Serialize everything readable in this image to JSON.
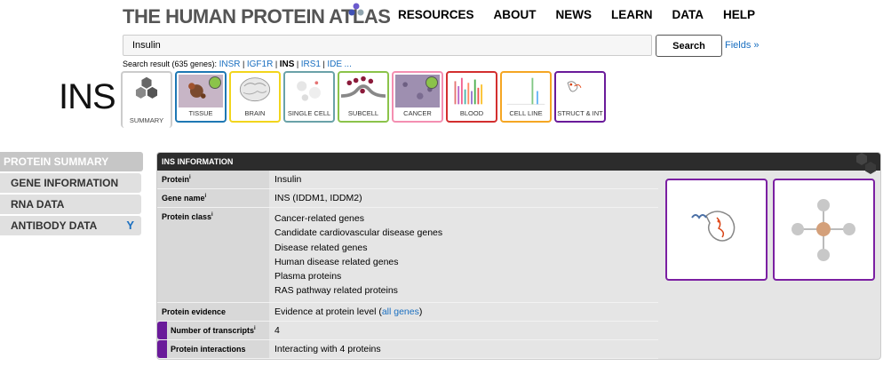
{
  "header": {
    "logo_text": "THE HUMAN PROTEIN ATLAS",
    "nav": [
      "RESOURCES",
      "ABOUT",
      "NEWS",
      "LEARN",
      "DATA",
      "HELP"
    ]
  },
  "search": {
    "value": "Insulin",
    "button_label": "Search",
    "fields_link": "Fields »",
    "result_prefix": "Search result (635 genes):",
    "results": [
      "INSR",
      "IGF1R",
      "INS",
      "IRS1",
      "IDE",
      "..."
    ],
    "result_sep": "|"
  },
  "gene": {
    "symbol": "INS"
  },
  "tabs": [
    {
      "label": "SUMMARY",
      "color": "#cccccc"
    },
    {
      "label": "TISSUE",
      "color": "#1e78b4"
    },
    {
      "label": "BRAIN",
      "color": "#f2d51c"
    },
    {
      "label": "SINGLE CELL",
      "color": "#6aa2a8"
    },
    {
      "label": "SUBCELL",
      "color": "#8bc34a"
    },
    {
      "label": "CANCER",
      "color": "#f48fb1"
    },
    {
      "label": "BLOOD",
      "color": "#d32f2f"
    },
    {
      "label": "CELL LINE",
      "color": "#f5a623"
    },
    {
      "label": "STRUCT & INT",
      "color": "#6a1b9a"
    }
  ],
  "sidebar": {
    "items": [
      "PROTEIN SUMMARY",
      "GENE INFORMATION",
      "RNA DATA",
      "ANTIBODY DATA"
    ]
  },
  "info": {
    "title": "INS INFORMATION",
    "protein_label": "Protein",
    "protein_value": "Insulin",
    "gene_name_label": "Gene name",
    "gene_name_value": "INS (IDDM1, IDDM2)",
    "protein_class_label": "Protein class",
    "protein_class_values": [
      "Cancer-related genes",
      "Candidate cardiovascular disease genes",
      "Disease related genes",
      "Human disease related genes",
      "Plasma proteins",
      "RAS pathway related proteins"
    ],
    "evidence_label": "Protein evidence",
    "evidence_value": "Evidence at protein level (",
    "evidence_link": "all genes",
    "evidence_close": ")",
    "transcripts_label": "Number of transcripts",
    "transcripts_value": "4",
    "interactions_label": "Protein interactions",
    "interactions_value": "Interacting with 4 proteins",
    "superscript": "i"
  },
  "colors": {
    "accent": "#1a6fc0",
    "struct_purple": "#6a1b9a",
    "panel_header": "#2c2c2c"
  }
}
